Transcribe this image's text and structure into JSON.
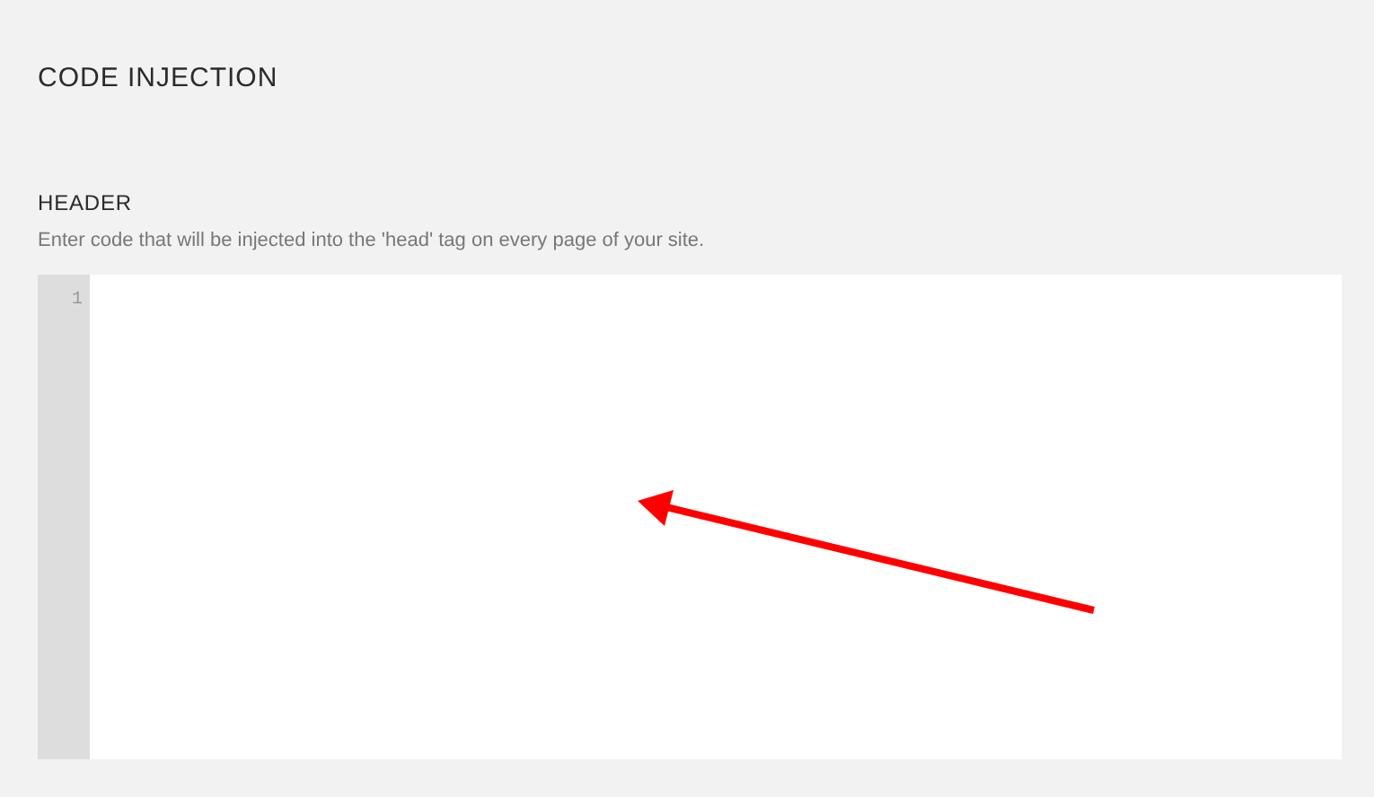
{
  "title": "CODE INJECTION",
  "section": {
    "heading": "HEADER",
    "description": "Enter code that will be injected into the 'head' tag on every page of your site.",
    "editor": {
      "line_numbers": [
        "1"
      ]
    }
  }
}
